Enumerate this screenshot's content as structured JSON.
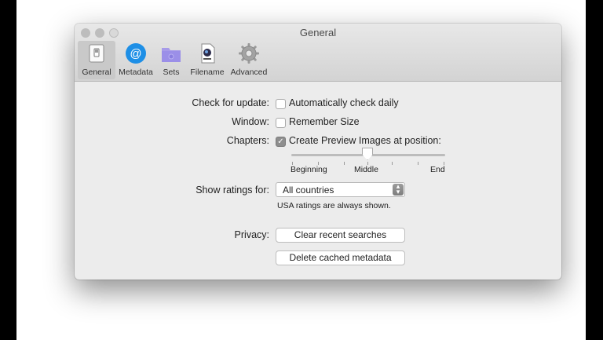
{
  "window": {
    "title": "General"
  },
  "tabs": [
    {
      "label": "General",
      "icon": "general-switch-icon",
      "selected": true
    },
    {
      "label": "Metadata",
      "icon": "at-sign-icon",
      "selected": false
    },
    {
      "label": "Sets",
      "icon": "folder-icon",
      "selected": false
    },
    {
      "label": "Filename",
      "icon": "document-icon",
      "selected": false
    },
    {
      "label": "Advanced",
      "icon": "gear-icon",
      "selected": false
    }
  ],
  "settings": {
    "check_update_label": "Check for update:",
    "auto_check_label": "Automatically check daily",
    "auto_check_checked": false,
    "window_label": "Window:",
    "remember_size_label": "Remember Size",
    "remember_size_checked": false,
    "chapters_label": "Chapters:",
    "preview_images_label": "Create Preview Images at position:",
    "preview_images_checked": true,
    "slider": {
      "left_label": "Beginning",
      "mid_label": "Middle",
      "right_label": "End",
      "value": 0.5
    },
    "ratings_label": "Show ratings for:",
    "ratings_value": "All countries",
    "ratings_note": "USA ratings are always shown.",
    "privacy_label": "Privacy:",
    "clear_searches_button": "Clear recent searches",
    "delete_cache_button": "Delete cached metadata"
  },
  "colors": {
    "accent_blue": "#1e8fe6",
    "folder_purple": "#9b8fe8"
  }
}
